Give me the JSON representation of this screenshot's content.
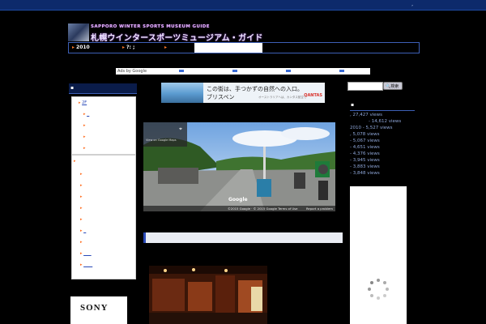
{
  "topbar": {
    "note": ","
  },
  "header": {
    "logo_en": "SAPPORO WINTER SPORTS MUSEUM GUIDE",
    "logo_jp": "札幌ウインタースポーツミュージアム・ガイド"
  },
  "nav": {
    "items": [
      {
        "label": "2010"
      },
      {
        "label": "?: ;"
      },
      {
        "label": ""
      }
    ]
  },
  "adbar": {
    "label": "Ads by Google"
  },
  "left_sidebar": {
    "heading": "▪",
    "panel1": {
      "first_link": "2F"
    },
    "panel2": {
      "marker": "▸"
    }
  },
  "ad_banner": {
    "line1": "この街は、手つかずの自然への入口。",
    "line2": "ブリスベン",
    "small": "オーストラリアへは、カンタス航空で",
    "brand": "QANTAS"
  },
  "sony_ad": {
    "brand": "SONY"
  },
  "streetview": {
    "info": "View on Google Maps",
    "google": "Google",
    "copyright": "©2015 Google · © 2015 Google    Terms of Use",
    "report": "Report a problem"
  },
  "search": {
    "button_label": "検索",
    "placeholder": ""
  },
  "right_sidebar": {
    "heading": "▪",
    "stats": [
      ", 27,427 views",
      "- 14,612 views",
      "2010 - 5,527 views",
      ", 5,078 views",
      "- 5,067 views",
      "- 4,651 views",
      "- 4,376 views",
      "- 3,945 views",
      "- 3,883 views",
      "- 3,848 views"
    ]
  },
  "colors": {
    "topbar": "#0d2a6b",
    "nav_border": "#3d5fb5",
    "accent_orange": "#ff7a2a",
    "link_blue": "#2a4ab8"
  }
}
